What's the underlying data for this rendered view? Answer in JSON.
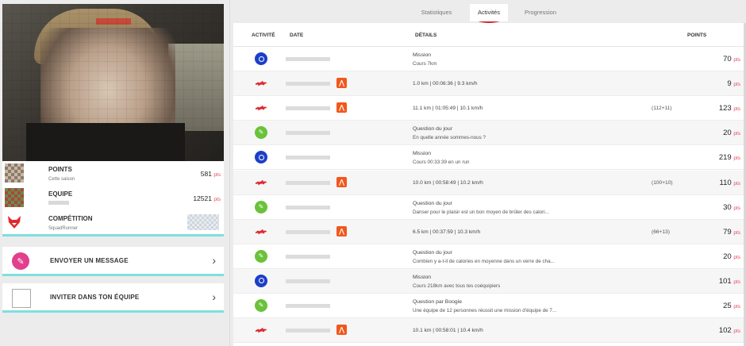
{
  "tabs": [
    {
      "label": "Statistiques",
      "active": false
    },
    {
      "label": "Activités",
      "active": true
    },
    {
      "label": "Progression",
      "active": false
    }
  ],
  "profile": {
    "stats": [
      {
        "title": "POINTS",
        "subtitle": "Cette saison",
        "value": "581",
        "unit": "pts",
        "icon": "avatar-mosaic-icon"
      },
      {
        "title": "EQUIPE",
        "subtitle": "",
        "value": "12521",
        "unit": "pts",
        "icon": "team-mosaic-icon"
      },
      {
        "title": "COMPÉTITION",
        "subtitle": "SquadRunner",
        "value": "",
        "unit": "",
        "icon": "fox-icon"
      }
    ],
    "actions": [
      {
        "label": "ENVOYER UN MESSAGE",
        "icon": "message-icon"
      },
      {
        "label": "INVITER DANS TON ÉQUIPE",
        "icon": "broken-image-icon"
      }
    ]
  },
  "table": {
    "headers": {
      "activity": "ACTIVITÉ",
      "date": "DATE",
      "details": "DÉTAILS",
      "points": "POINTS"
    },
    "unit": "pts",
    "rows": [
      {
        "type": "mission",
        "strava": false,
        "line1": "Mission",
        "line2": "Cours 7km",
        "bonus": "",
        "points": "70"
      },
      {
        "type": "run",
        "strava": true,
        "line1": "1.0 km | 00:06:36 | 9.3 km/h",
        "line2": "",
        "bonus": "",
        "points": "9"
      },
      {
        "type": "run",
        "strava": true,
        "line1": "11.1 km | 01:05:49 | 10.1 km/h",
        "line2": "",
        "bonus": "(112+11)",
        "points": "123"
      },
      {
        "type": "question",
        "strava": false,
        "line1": "Question du jour",
        "line2": "En quelle année sommes-nous ?",
        "bonus": "",
        "points": "20"
      },
      {
        "type": "mission",
        "strava": false,
        "line1": "Mission",
        "line2": "Cours 00:33:39 en un run",
        "bonus": "",
        "points": "219"
      },
      {
        "type": "run",
        "strava": true,
        "line1": "10.0 km | 00:58:49 | 10.2 km/h",
        "line2": "",
        "bonus": "(100+10)",
        "points": "110"
      },
      {
        "type": "question",
        "strava": false,
        "line1": "Question du jour",
        "line2": "Danser pour le plaisir est un bon moyen de brûler des calori...",
        "bonus": "",
        "points": "30"
      },
      {
        "type": "run",
        "strava": true,
        "line1": "6.5 km | 00:37:59 | 10.3 km/h",
        "line2": "",
        "bonus": "(66+13)",
        "points": "79"
      },
      {
        "type": "question",
        "strava": false,
        "line1": "Question du jour",
        "line2": "Combien y a-t-il de calories en moyenne dans un verre de cha...",
        "bonus": "",
        "points": "20"
      },
      {
        "type": "mission",
        "strava": false,
        "line1": "Mission",
        "line2": "Cours 218km avec tous tes coéquipiers",
        "bonus": "",
        "points": "101"
      },
      {
        "type": "question",
        "strava": false,
        "line1": "Question par Boogie",
        "line2": "Une équipe de 12 personnes réussit une mission d'équipe de 7...",
        "bonus": "",
        "points": "25"
      },
      {
        "type": "run",
        "strava": true,
        "line1": "10.1 km | 00:58:01 | 10.4 km/h",
        "line2": "",
        "bonus": "",
        "points": "102"
      }
    ]
  },
  "colors": {
    "accent": "#e9465d",
    "underline": "#7fdfe0",
    "mission": "#1c3fc9",
    "question": "#6ac23a",
    "strava": "#f2571c",
    "fox": "#e0292f"
  }
}
